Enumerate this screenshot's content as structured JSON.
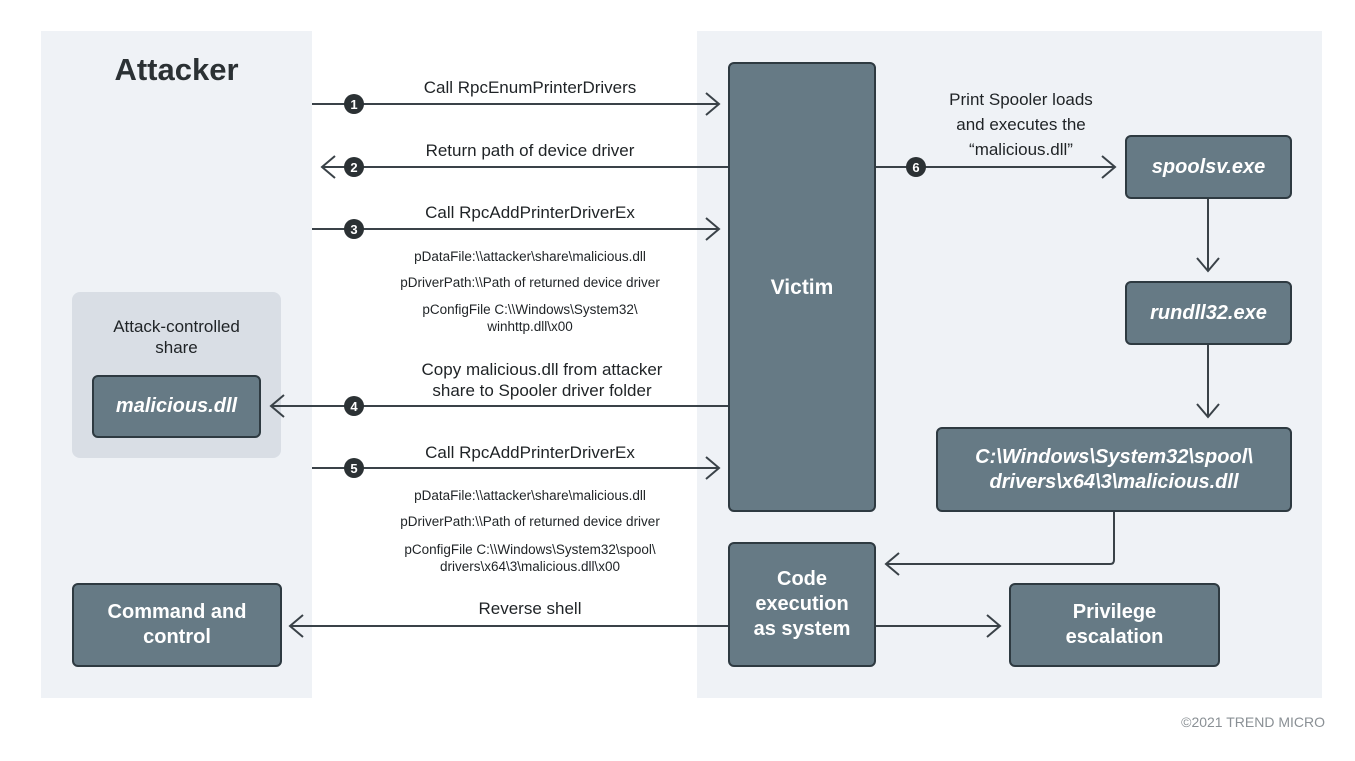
{
  "title": "Attacker",
  "share": {
    "label": "Attack-controlled share",
    "file": "malicious.dll"
  },
  "victim": {
    "label": "Victim"
  },
  "steps": [
    {
      "num": "1",
      "label": "Call RpcEnumPrinterDrivers",
      "direction": "attacker-to-victim"
    },
    {
      "num": "2",
      "label": "Return path of device driver",
      "direction": "victim-to-attacker"
    },
    {
      "num": "3",
      "label": "Call RpcAddPrinterDriverEx",
      "direction": "attacker-to-victim",
      "params": [
        "pDataFile:\\\\attacker\\share\\malicious.dll",
        "pDriverPath:\\\\Path of returned device driver",
        "pConfigFile C:\\\\Windows\\System32\\",
        "winhttp.dll\\x00"
      ]
    },
    {
      "num": "4",
      "label_lines": [
        "Copy malicious.dll from attacker",
        "share to Spooler driver folder"
      ],
      "direction": "victim-to-share"
    },
    {
      "num": "5",
      "label": "Call RpcAddPrinterDriverEx",
      "direction": "attacker-to-victim",
      "params": [
        "pDataFile:\\\\attacker\\share\\malicious.dll",
        "pDriverPath:\\\\Path of returned device driver",
        "pConfigFile C:\\\\Windows\\System32\\spool\\",
        "drivers\\x64\\3\\malicious.dll\\x00"
      ]
    },
    {
      "num": "6",
      "label_lines": [
        "Print Spooler loads",
        "and executes the",
        "“malicious.dll”"
      ],
      "direction": "victim-to-spoolsv"
    }
  ],
  "process_chain": {
    "spoolsv": "spoolsv.exe",
    "rundll": "rundll32.exe",
    "dll_path_lines": [
      "C:\\Windows\\System32\\spool\\",
      "drivers\\x64\\3\\malicious.dll"
    ]
  },
  "code_exec": {
    "lines": [
      "Code",
      "execution",
      "as system"
    ]
  },
  "priv_esc": {
    "lines": [
      "Privilege",
      "escalation"
    ]
  },
  "c2": {
    "lines": [
      "Command and",
      "control"
    ]
  },
  "reverse_shell": "Reverse shell",
  "copyright": "©2021 TREND MICRO",
  "colors": {
    "panel_bg": "#eff2f6",
    "share_bg": "#d9dee5",
    "box_fill": "#667a85",
    "box_border": "#2e3a41",
    "line": "#3a4248",
    "badge": "#2b3134"
  }
}
